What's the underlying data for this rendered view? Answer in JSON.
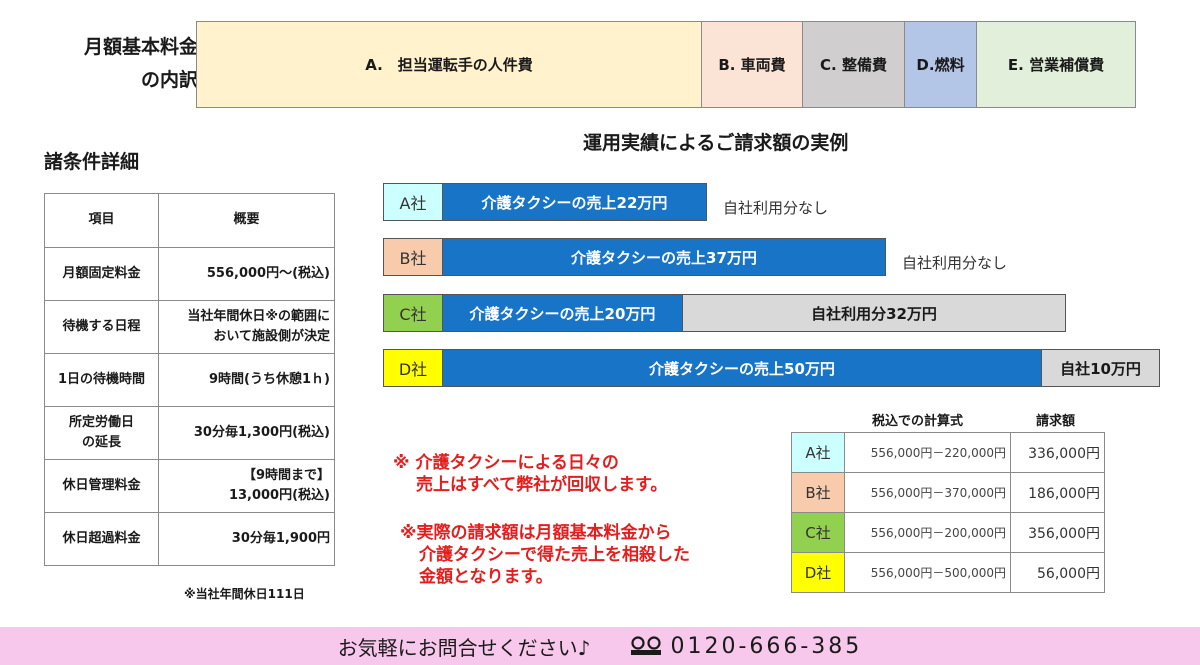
{
  "breakdown": {
    "label_line1": "月額基本料金",
    "label_line2": "の内訳",
    "segments": [
      {
        "label": "A.　担当運転手の人件費",
        "color": "#fff2cc"
      },
      {
        "label": "B. 車両費",
        "color": "#fbe4d5"
      },
      {
        "label": "C. 整備費",
        "color": "#d0cece"
      },
      {
        "label": "D.燃料",
        "color": "#b4c6e7"
      },
      {
        "label": "E. 営業補償費",
        "color": "#e2efda"
      }
    ]
  },
  "conditions": {
    "title": "諸条件詳細",
    "header": {
      "item": "項目",
      "summary": "概要"
    },
    "rows": [
      {
        "item": "月額固定料金",
        "value": "556,000円～(税込)"
      },
      {
        "item": "待機する日程",
        "value_line1": "当社年間休日※の範囲に",
        "value_line2": "おいて施設側が決定"
      },
      {
        "item": "1日の待機時間",
        "value": "9時間(うち休憩1ｈ)"
      },
      {
        "item_line1": "所定労働日",
        "item_line2": "の延長",
        "value": "30分毎1,300円(税込)"
      },
      {
        "item": "休日管理料金",
        "value_line1": "【9時間まで】",
        "value_line2": "13,000円(税込)"
      },
      {
        "item": "休日超過料金",
        "value": "30分毎1,900円"
      }
    ],
    "note": "※当社年間休日111日"
  },
  "examples": {
    "title": "運用実績によるご請求額の実例",
    "companies": [
      {
        "name": "A社",
        "color": "#ccffff",
        "sales": "介護タクシーの売上22万円",
        "after": "自社利用分なし"
      },
      {
        "name": "B社",
        "color": "#f8cbad",
        "sales": "介護タクシーの売上37万円",
        "after": "自社利用分なし"
      },
      {
        "name": "C社",
        "color": "#92d050",
        "sales": "介護タクシーの売上20万円",
        "own": "自社利用分32万円"
      },
      {
        "name": "D社",
        "color": "#ffff00",
        "sales": "介護タクシーの売上50万円",
        "own": "自社10万円"
      }
    ]
  },
  "notes": {
    "note1_line1": "※ 介護タクシーによる日々の",
    "note1_line2": "売上はすべて弊社が回収します。",
    "note2_line1": "※実際の請求額は月額基本料金から",
    "note2_line2": "介護タクシーで得た売上を相殺した",
    "note2_line3": "金額となります。"
  },
  "calc": {
    "header_formula": "税込での計算式",
    "header_amount": "請求額",
    "rows": [
      {
        "name": "A社",
        "color": "#ccffff",
        "formula": "556,000円－220,000円",
        "amount": "336,000円"
      },
      {
        "name": "B社",
        "color": "#f8cbad",
        "formula": "556,000円－370,000円",
        "amount": "186,000円"
      },
      {
        "name": "C社",
        "color": "#92d050",
        "formula": "556,000円－200,000円",
        "amount": "356,000円"
      },
      {
        "name": "D社",
        "color": "#ffff00",
        "formula": "556,000円－500,000円",
        "amount": "56,000円"
      }
    ]
  },
  "footer": {
    "text": "お気軽にお問合せください♪",
    "phone_icon": "free-dial-icon",
    "phone": "0120-666-385"
  }
}
